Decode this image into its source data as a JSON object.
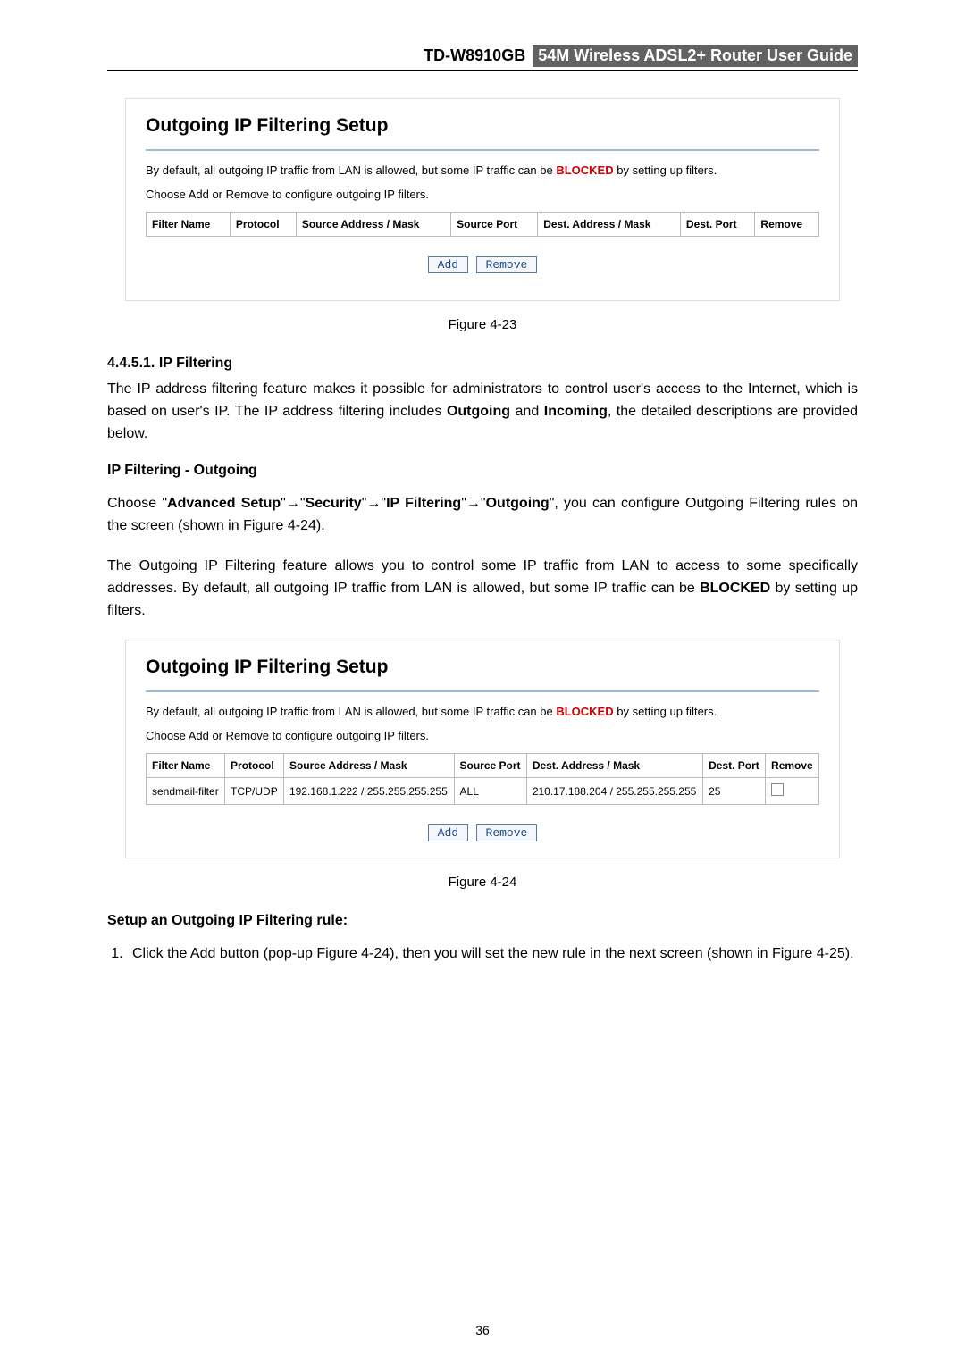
{
  "header": {
    "model": "TD-W8910GB",
    "title": "54M  Wireless  ADSL2+  Router  User  Guide"
  },
  "panel1": {
    "title": "Outgoing IP Filtering Setup",
    "intro_before": "By default, all outgoing IP traffic from LAN is allowed, but some IP traffic can be ",
    "blocked": "BLOCKED",
    "intro_after": " by setting up filters.",
    "choose": "Choose Add or Remove to configure outgoing IP filters.",
    "headers": {
      "filter_name": "Filter Name",
      "protocol": "Protocol",
      "src_addr": "Source Address / Mask",
      "src_port": "Source Port",
      "dst_addr": "Dest. Address / Mask",
      "dst_port": "Dest. Port",
      "remove": "Remove"
    },
    "add": "Add",
    "remove": "Remove"
  },
  "caption1": "Figure 4-23",
  "section": {
    "num_title": "4.4.5.1.  IP Filtering",
    "para1_a": "The IP address filtering feature makes it possible for administrators to control user's access to the Internet, which is based on user's IP. The IP address filtering includes ",
    "outgoing": "Outgoing",
    "and": " and ",
    "incoming": "Incoming",
    "para1_b": ", the detailed descriptions are provided below.",
    "sub": "IP Filtering - Outgoing",
    "para2_a": "Choose  \"",
    "adv": "Advanced  Setup",
    "arrow": "→",
    "q1": "\"",
    "sec": "Security",
    "ipf": "IP  Filtering",
    "out": "Outgoing",
    "para2_b": "\",  you  can  configure Outgoing Filtering rules on the screen (shown in Figure 4-24).",
    "para3_a": "The Outgoing IP Filtering feature allows you to control some IP traffic from LAN to access to some specifically addresses. By default, all outgoing IP traffic from LAN is allowed, but some IP traffic can be ",
    "blocked": "BLOCKED",
    "para3_b": " by setting up filters."
  },
  "panel2": {
    "title": "Outgoing IP Filtering Setup",
    "intro_before": "By default, all outgoing IP traffic from LAN is allowed, but some IP traffic can be ",
    "blocked": "BLOCKED",
    "intro_after": " by setting up filters.",
    "choose": "Choose Add or Remove to configure outgoing IP filters.",
    "headers": {
      "filter_name": "Filter Name",
      "protocol": "Protocol",
      "src_addr": "Source Address / Mask",
      "src_port": "Source Port",
      "dst_addr": "Dest. Address / Mask",
      "dst_port": "Dest. Port",
      "remove": "Remove"
    },
    "row": {
      "filter_name": "sendmail-filter",
      "protocol": "TCP/UDP",
      "src_addr": "192.168.1.222 / 255.255.255.255",
      "src_port": "ALL",
      "dst_addr": "210.17.188.204 / 255.255.255.255",
      "dst_port": "25"
    },
    "add": "Add",
    "remove": "Remove"
  },
  "caption2": "Figure 4-24",
  "setup": {
    "heading": "Setup an Outgoing IP Filtering rule:",
    "step1_a": "Click the ",
    "step1_add": "Add",
    "step1_b": " button (pop-up Figure 4-24), then you will set the new rule in the next screen (shown in Figure 4-25)."
  },
  "page_number": "36"
}
